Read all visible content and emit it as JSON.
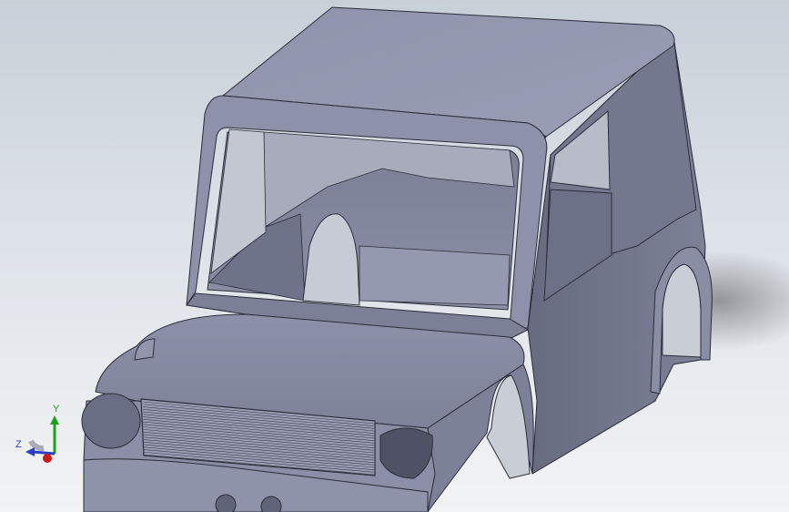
{
  "viewport": {
    "background_top": "#c7cfd8",
    "background_bottom": "#f2f3f5",
    "model_fill": "#878ba3",
    "model_edge": "#2b2d38"
  },
  "triad": {
    "x_label": "",
    "y_label": "Y",
    "z_label": "Z",
    "y_color": "#1aa31a",
    "z_color": "#2a3fc8",
    "x_color": "#c81a1a"
  }
}
